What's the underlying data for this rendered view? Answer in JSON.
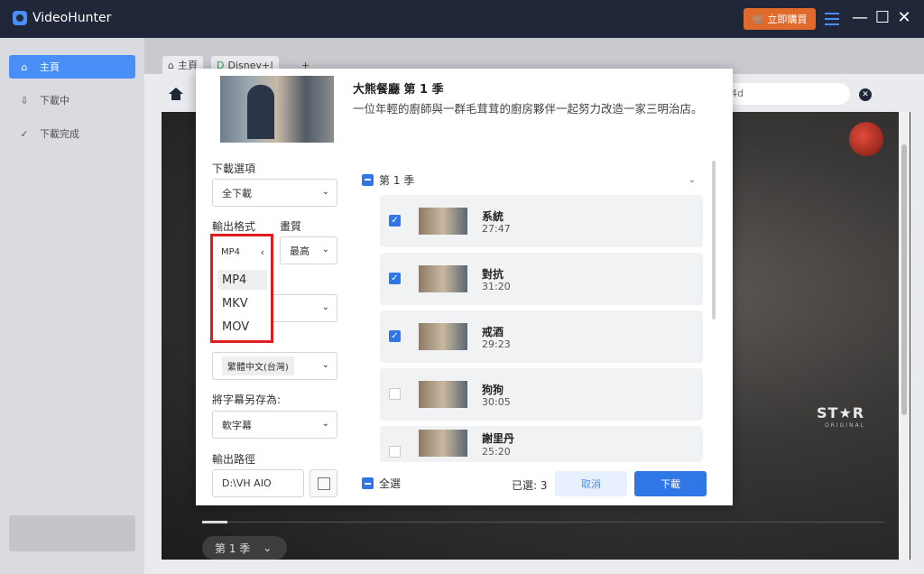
{
  "app": {
    "title": "VideoHunter",
    "buy_label": "立即購買"
  },
  "sidebar": {
    "items": [
      {
        "label": "主頁",
        "icon": "home-icon",
        "active": true
      },
      {
        "label": "下載中",
        "icon": "download-icon",
        "active": false
      },
      {
        "label": "下載完成",
        "icon": "check-circle-icon",
        "active": false
      }
    ]
  },
  "browser": {
    "tabs": [
      {
        "label": "主頁",
        "icon": "home-icon"
      },
      {
        "label": "Disney+|",
        "icon": "disney-icon"
      }
    ],
    "add_tab": "+",
    "address_text": "4d",
    "video_logo": "ST★R",
    "video_logo_sub": "ORIGINAL",
    "season_pill": "第 1 季"
  },
  "modal": {
    "show_title": "大熊餐廳 第 1 季",
    "show_desc": "一位年輕的廚師與一群毛茸茸的廚房夥伴一起努力改造一家三明治店。",
    "download_option_label": "下載選項",
    "download_option_value": "全下載",
    "format_label": "輸出格式",
    "format_value": "MP4",
    "quality_label": "畫質",
    "quality_value": "最高",
    "format_options": [
      "MP4",
      "MKV",
      "MOV"
    ],
    "subtitle_lang_value": "繁體中文(台灣)",
    "subtitle_save_label": "將字幕另存為:",
    "subtitle_save_value": "軟字幕",
    "output_path_label": "輸出路徑",
    "output_path_value": "D:\\VH AIO",
    "season_label": "第 1 季",
    "episodes": [
      {
        "title": "系統",
        "duration": "27:47",
        "checked": true
      },
      {
        "title": "對抗",
        "duration": "31:20",
        "checked": true
      },
      {
        "title": "戒酒",
        "duration": "29:23",
        "checked": true
      },
      {
        "title": "狗狗",
        "duration": "30:05",
        "checked": false
      },
      {
        "title": "謝里丹",
        "duration": "25:20",
        "checked": false
      }
    ],
    "select_all_label": "全選",
    "selected_count": "已選: 3",
    "cancel_label": "取消",
    "download_label": "下載"
  },
  "colors": {
    "accent": "#2f77e6",
    "highlight": "#e01c1c",
    "titlebar": "#1f2738",
    "buy": "#e06a2c"
  }
}
